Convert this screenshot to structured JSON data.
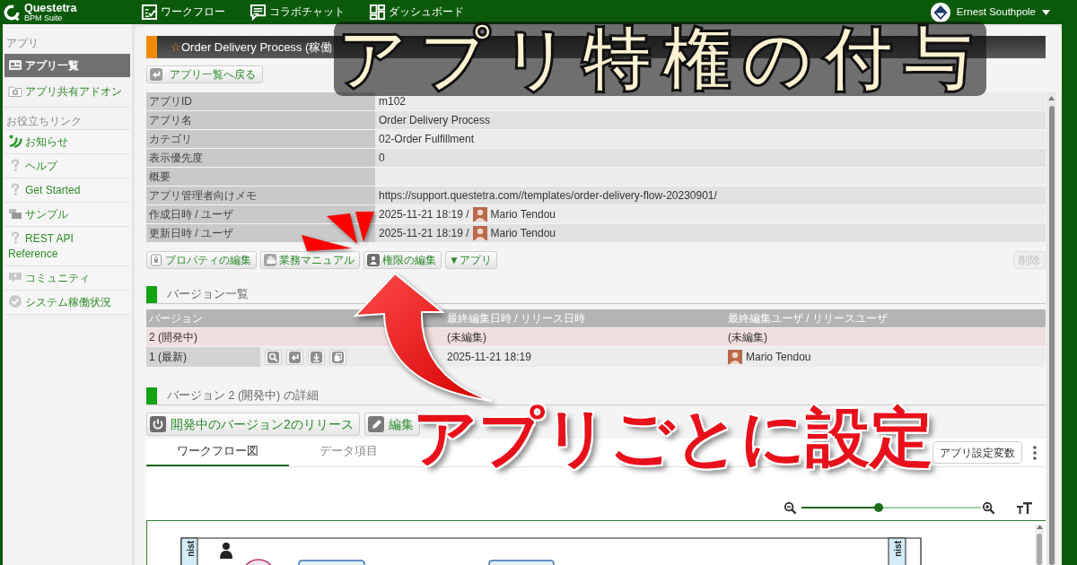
{
  "top_bar": {
    "logo": {
      "name": "Questetra",
      "tagline": "BPM Suite"
    },
    "nav": [
      {
        "label": "ワークフロー"
      },
      {
        "label": "コラボチャット"
      },
      {
        "label": "ダッシュボード"
      }
    ],
    "user": {
      "name": "Ernest Southpole"
    }
  },
  "sidebar": {
    "sections": [
      {
        "heading": "アプリ",
        "items": [
          {
            "label": "アプリ一覧",
            "selected": true
          },
          {
            "label": "アプリ共有アドオン",
            "selected": false
          }
        ]
      },
      {
        "heading": "お役立ちリンク",
        "items": [
          {
            "label": "お知らせ",
            "selected": false
          },
          {
            "label": "ヘルプ",
            "selected": false
          },
          {
            "label": "Get Started",
            "selected": false
          },
          {
            "label": "サンプル",
            "selected": false
          },
          {
            "label": "REST API Reference",
            "selected": false
          },
          {
            "label": "コミュニティ",
            "selected": false
          },
          {
            "label": "システム稼働状況",
            "selected": false
          }
        ]
      }
    ]
  },
  "title_bar": {
    "star": "☆",
    "title": "Order Delivery Process (稼働"
  },
  "back_button": {
    "label": "アプリ一覧へ戻る"
  },
  "properties": [
    {
      "label": "アプリID",
      "value": "m102"
    },
    {
      "label": "アプリ名",
      "value": "Order Delivery Process"
    },
    {
      "label": "カテゴリ",
      "value": "02-Order Fulfillment"
    },
    {
      "label": "表示優先度",
      "value": "0"
    },
    {
      "label": "概要"
    },
    {
      "label": "アプリ管理者向けメモ",
      "value": "https://support.questetra.com//templates/order-delivery-flow-20230901/"
    },
    {
      "label": "作成日時 / ユーザ",
      "value": "2025-11-21 18:19 /",
      "user": "Mario Tendou"
    },
    {
      "label": "更新日時 / ユーザ",
      "value": "2025-11-21 18:19 /",
      "user": "Mario Tendou"
    }
  ],
  "actions": [
    {
      "label": "プロパティの編集",
      "kind": "action"
    },
    {
      "label": "業務マニュアル",
      "kind": "action"
    },
    {
      "label": "権限の編集",
      "kind": "action"
    },
    {
      "label": "▼アプリ",
      "kind": "menu"
    }
  ],
  "delete_button": {
    "label": "削除",
    "disabled": true
  },
  "versions": {
    "heading": "バージョン一覧",
    "columns": [
      "バージョン",
      "最終編集日時 / リリース日時",
      "最終編集ユーザ / リリースユーザ"
    ],
    "rows": [
      {
        "version": "2 (開発中)",
        "edited": "(未編集)",
        "user": "(未編集)",
        "highlighted": true,
        "tools": false,
        "avatar": false
      },
      {
        "version": "1 (最新)",
        "edited": "2025-11-21 18:19",
        "user": "Mario Tendou",
        "highlighted": false,
        "tools": true,
        "avatar": true
      }
    ]
  },
  "detail": {
    "heading": "バージョン 2 (開発中) の詳細",
    "buttons": [
      {
        "label": "開発中のバージョン2のリリース"
      },
      {
        "label": "編集"
      }
    ],
    "tabs": [
      {
        "label": "ワークフロー図",
        "selected": true
      },
      {
        "label": "データ項目",
        "selected": false
      }
    ],
    "settings_button": {
      "label": "アプリ設定変数"
    },
    "zoom": {
      "level": 0.43
    },
    "lanes": [
      {
        "label": "nist"
      },
      {
        "label": "nist"
      }
    ]
  },
  "overlays": {
    "headline": "アプリ特権の付与",
    "caption": "アプリごとに設定"
  }
}
